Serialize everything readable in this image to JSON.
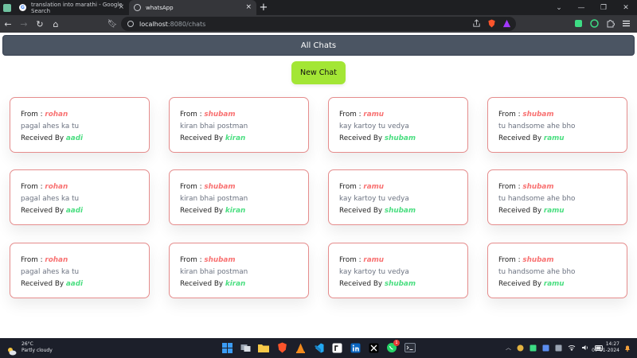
{
  "browser": {
    "tabs": [
      {
        "title": "translation into marathi - Google Search",
        "active": false
      },
      {
        "title": "whatsApp",
        "active": true
      }
    ],
    "url_host": "localhost",
    "url_path": ":8080/chats"
  },
  "page": {
    "header_title": "All Chats",
    "new_chat_label": "New Chat",
    "chats": [
      {
        "from_label": "From : ",
        "from": "rohan",
        "message": "pagal ahes ka tu",
        "received_label": "Received By ",
        "to": "aadi"
      },
      {
        "from_label": "From : ",
        "from": "shubam",
        "message": "kiran bhai postman",
        "received_label": "Received By ",
        "to": "kiran"
      },
      {
        "from_label": "From : ",
        "from": "ramu",
        "message": "kay kartoy tu vedya",
        "received_label": "Received By ",
        "to": "shubam"
      },
      {
        "from_label": "From : ",
        "from": "shubam",
        "message": "tu handsome ahe bho",
        "received_label": "Received By ",
        "to": "ramu"
      },
      {
        "from_label": "From : ",
        "from": "rohan",
        "message": "pagal ahes ka tu",
        "received_label": "Received By ",
        "to": "aadi"
      },
      {
        "from_label": "From : ",
        "from": "shubam",
        "message": "kiran bhai postman",
        "received_label": "Received By ",
        "to": "kiran"
      },
      {
        "from_label": "From : ",
        "from": "ramu",
        "message": "kay kartoy tu vedya",
        "received_label": "Received By ",
        "to": "shubam"
      },
      {
        "from_label": "From : ",
        "from": "shubam",
        "message": "tu handsome ahe bho",
        "received_label": "Received By ",
        "to": "ramu"
      },
      {
        "from_label": "From : ",
        "from": "rohan",
        "message": "pagal ahes ka tu",
        "received_label": "Received By ",
        "to": "aadi"
      },
      {
        "from_label": "From : ",
        "from": "shubam",
        "message": "kiran bhai postman",
        "received_label": "Received By ",
        "to": "kiran"
      },
      {
        "from_label": "From : ",
        "from": "ramu",
        "message": "kay kartoy tu vedya",
        "received_label": "Received By ",
        "to": "shubam"
      },
      {
        "from_label": "From : ",
        "from": "shubam",
        "message": "tu handsome ahe bho",
        "received_label": "Received By ",
        "to": "ramu"
      }
    ]
  },
  "taskbar": {
    "temperature": "26°C",
    "weather": "Partly cloudy",
    "time": "14:27",
    "date": "07-01-2024",
    "whatsapp_badge": "1"
  },
  "colors": {
    "header_bg": "#4b5563",
    "new_chat_bg": "#a3e635",
    "from_name": "#f87171",
    "to_name": "#4ade80",
    "card_border": "#e58c8c"
  },
  "icons": {
    "sidebar": "sidebar-panel-icon",
    "tab1": "google-icon",
    "tab2": "globe-icon",
    "new_tab": "plus-icon",
    "back": "arrow-left-icon",
    "forward": "arrow-right-icon",
    "reload": "reload-icon",
    "home": "home-icon",
    "bookmark": "bookmark-icon",
    "share": "share-icon",
    "brave": "brave-shield-icon",
    "rewards": "brave-rewards-icon",
    "extensions": "puzzle-icon",
    "menu": "hamburger-menu-icon"
  }
}
